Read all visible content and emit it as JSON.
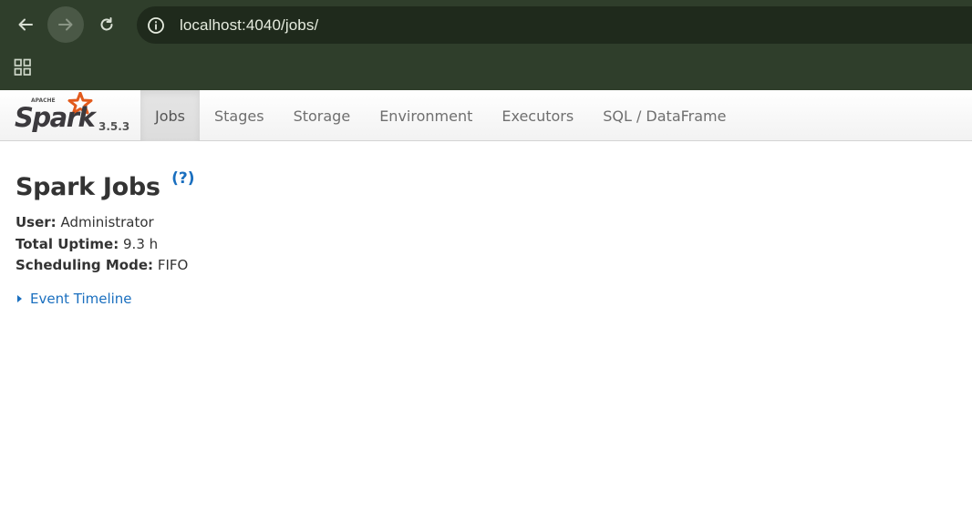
{
  "browser": {
    "url": "localhost:4040/jobs/",
    "icons": {
      "back": "arrow-left-icon",
      "forward": "arrow-right-icon",
      "reload": "reload-icon",
      "site_info": "info-circle-icon",
      "apps": "apps-grid-icon"
    }
  },
  "header": {
    "logo_small_text": "APACHE",
    "logo_text": "Spark",
    "version": "3.5.3",
    "tabs": [
      {
        "label": "Jobs",
        "active": true
      },
      {
        "label": "Stages",
        "active": false
      },
      {
        "label": "Storage",
        "active": false
      },
      {
        "label": "Environment",
        "active": false
      },
      {
        "label": "Executors",
        "active": false
      },
      {
        "label": "SQL / DataFrame",
        "active": false
      }
    ]
  },
  "main": {
    "title": "Spark Jobs",
    "help": "(?)",
    "info": [
      {
        "label": "User:",
        "value": "Administrator"
      },
      {
        "label": "Total Uptime:",
        "value": "9.3 h"
      },
      {
        "label": "Scheduling Mode:",
        "value": "FIFO"
      }
    ],
    "event_timeline": "Event Timeline"
  },
  "colors": {
    "chrome_bg": "#2f3e2b",
    "address_bg": "#1f2a1c",
    "link": "#1a6fbf",
    "logo_star": "#e25a1c"
  }
}
